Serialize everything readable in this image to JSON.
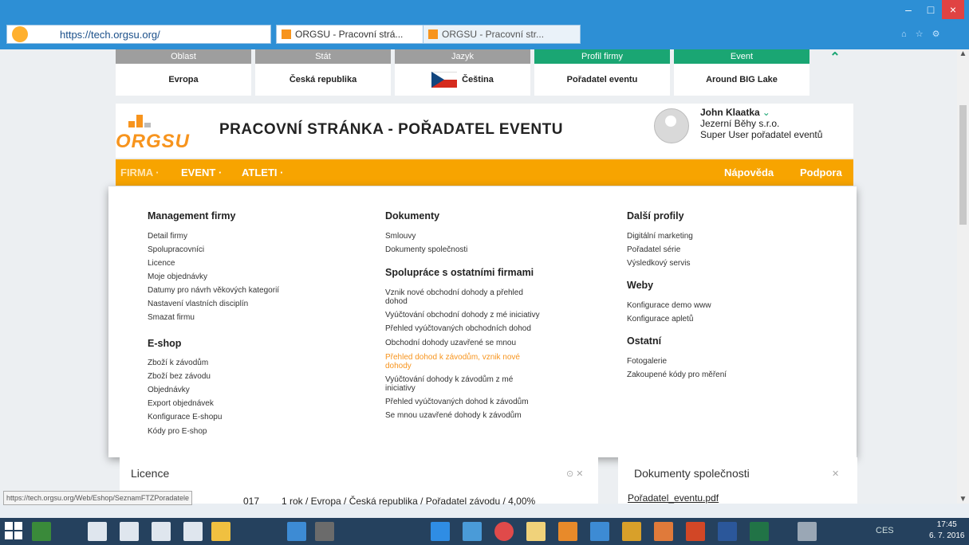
{
  "browser": {
    "url": "https://tech.orgsu.org/",
    "tabs": [
      "ORGSU - Pracovní strá...",
      "ORGSU - Pracovní str..."
    ],
    "close_symbol": "×",
    "minimize_symbol": "–",
    "maximize_symbol": "□"
  },
  "selectors": [
    {
      "caption": "Oblast",
      "value": "Evropa"
    },
    {
      "caption": "Stát",
      "value": "Česká republika"
    },
    {
      "caption": "Jazyk",
      "value": "Čeština"
    },
    {
      "caption": "Profil firmy",
      "value": "Pořadatel eventu"
    },
    {
      "caption": "Event",
      "value": "Around BIG Lake"
    }
  ],
  "logo_text": "ORGSU",
  "page_title": "PRACOVNÍ STRÁNKA - POŘADATEL EVENTU",
  "user": {
    "name": "John Klaatka",
    "company": "Jezerní Běhy s.r.o.",
    "role": "Super User pořadatel eventů"
  },
  "nav": {
    "firma": "FIRMA ·",
    "event": "EVENT ·",
    "atleti": "ATLETI ·",
    "napoveda": "Nápověda",
    "podpora": "Podpora"
  },
  "menu": {
    "management": {
      "title": "Management firmy",
      "items": [
        "Detail firmy",
        "Spolupracovníci",
        "Licence",
        "Moje objednávky",
        "Datumy pro návrh věkových kategorií",
        "Nastavení vlastních disciplín",
        "Smazat firmu"
      ]
    },
    "eshop": {
      "title": "E-shop",
      "items": [
        "Zboží k závodům",
        "Zboží bez závodu",
        "Objednávky",
        "Export objednávek",
        "Konfigurace E-shopu",
        "Kódy pro E-shop"
      ]
    },
    "dokumenty": {
      "title": "Dokumenty",
      "items": [
        "Smlouvy",
        "Dokumenty společnosti"
      ]
    },
    "spoluprace": {
      "title": "Spolupráce s ostatními firmami",
      "items": [
        "Vznik nové obchodní dohody a přehled",
        "dohod",
        "Vyúčtování obchodní dohody z mé iniciativy",
        "Přehled vyúčtovaných obchodních dohod",
        "Obchodní dohody uzavřené se mnou",
        "Přehled dohod k závodům, vznik nové",
        "dohody",
        "Vyúčtování dohody k závodům z mé",
        "iniciativy",
        "Přehled vyúčtovaných dohod k závodům",
        "Se mnou uzavřené dohody k závodům"
      ]
    },
    "profily": {
      "title": "Další profily",
      "items": [
        "Digitální marketing",
        "Pořadatel série",
        "Výsledkový servis"
      ]
    },
    "weby": {
      "title": "Weby",
      "items": [
        "Konfigurace demo www",
        "Konfigurace apletů"
      ]
    },
    "ostatni": {
      "title": "Ostatní",
      "items": [
        "Fotogalerie",
        "Zakoupené kódy pro měření"
      ]
    }
  },
  "licence_panel": {
    "title": "Licence",
    "row_year": "017",
    "row_text": "1 rok / Evropa / Česká republika / Pořadatel závodu / 4,00%"
  },
  "docs_panel": {
    "title": "Dokumenty společnosti",
    "file": "Pořadatel_eventu.pdf"
  },
  "status_url": "https://tech.orgsu.org/Web/Eshop/SeznamFTZPoradatele",
  "clock": {
    "time": "17:45",
    "date": "6. 7. 2016"
  },
  "tray_lang": "CES",
  "icons": [
    "back-icon",
    "home-icon",
    "close-icon",
    "minimize-icon",
    "maximize-icon",
    "windows-start-icon",
    "chevron-down-icon",
    "avatar-icon"
  ]
}
